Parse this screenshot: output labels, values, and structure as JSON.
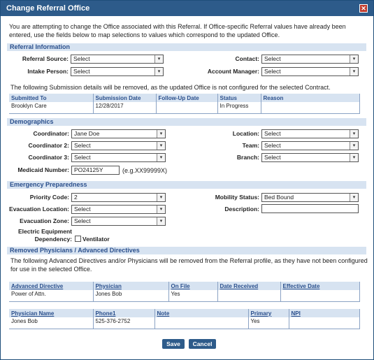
{
  "dialog": {
    "title": "Change Referral Office",
    "close_symbol": "✕"
  },
  "intro": "You are attempting to change the Office associated with this Referral.  If Office-specific Referral values have already been entered, use the fields below to map selections to values which correspond to the updated Office.",
  "referral": {
    "heading": "Referral Information",
    "source_label": "Referral Source:",
    "source_value": "Select",
    "contact_label": "Contact:",
    "contact_value": "Select",
    "intake_label": "Intake Person:",
    "intake_value": "Select",
    "account_label": "Account Manager:",
    "account_value": "Select"
  },
  "submission": {
    "note": "The following Submission details will be removed, as the updated Office is not configured for the selected Contract.",
    "headers": [
      "Submitted To",
      "Submission Date",
      "Follow-Up Date",
      "Status",
      "Reason"
    ],
    "row": [
      "Brooklyn Care",
      "12/28/2017",
      "",
      "In Progress",
      ""
    ]
  },
  "demographics": {
    "heading": "Demographics",
    "coord_label": "Coordinator:",
    "coord_value": "Jane Doe",
    "coord2_label": "Coordinator 2:",
    "coord2_value": "Select",
    "coord3_label": "Coordinator 3:",
    "coord3_value": "Select",
    "location_label": "Location:",
    "location_value": "Select",
    "team_label": "Team:",
    "team_value": "Select",
    "branch_label": "Branch:",
    "branch_value": "Select",
    "medicaid_label": "Medicaid Number:",
    "medicaid_value": "PO24125Y",
    "medicaid_hint": "(e.g.XX99999X)"
  },
  "emergency": {
    "heading": "Emergency Preparedness",
    "priority_label": "Priority Code:",
    "priority_value": "2",
    "evac_loc_label": "Evacuation Location:",
    "evac_loc_value": "Select",
    "evac_zone_label": "Evacuation Zone:",
    "evac_zone_value": "Select",
    "mobility_label": "Mobility Status:",
    "mobility_value": "Bed Bound",
    "description_label": "Description:",
    "description_value": "",
    "equip_label_1": "Electric Equipment",
    "equip_label_2": "Dependency:",
    "ventilator_label": "Ventilator"
  },
  "removed": {
    "heading": "Removed Physicians / Advanced Directives",
    "note": "The following Advanced Directives and/or Physicians will be removed from the Referral profile, as they have not been configured for use in the selected Office.",
    "directive_headers": [
      "Advanced Directive",
      "Physician",
      "On File",
      "Date Received",
      "Effective Date"
    ],
    "directive_row": [
      "Power of Attn.",
      "Jones Bob",
      "Yes",
      "",
      ""
    ],
    "physician_headers": [
      "Physician Name",
      "Phone1",
      "Note",
      "Primary",
      "NPI"
    ],
    "physician_row": [
      "Jones Bob",
      "525-376-2752",
      "",
      "Yes",
      ""
    ]
  },
  "buttons": {
    "save": "Save",
    "cancel": "Cancel"
  },
  "colors": {
    "titlebar": "#2d5b8a",
    "section_bg": "#d7e3f1",
    "section_text": "#2a4f8c",
    "close": "#c0392b"
  }
}
